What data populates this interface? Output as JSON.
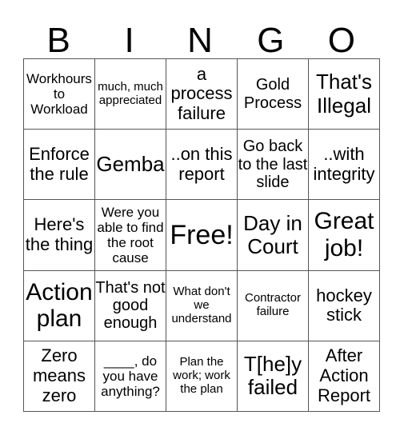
{
  "header": [
    "B",
    "I",
    "N",
    "G",
    "O"
  ],
  "rows": [
    [
      "Workhours to Workload",
      "much, much appreciated",
      "a process failure",
      "Gold Process",
      "That's Illegal"
    ],
    [
      "Enforce the rule",
      "Gemba",
      "..on this report",
      "Go back to the last slide",
      "..with integrity"
    ],
    [
      "Here's the thing",
      "Were you able to find the root cause",
      "Free!",
      "Day in Court",
      "Great job!"
    ],
    [
      "Action plan",
      "That's not good enough",
      "What don't we understand",
      "Contractor failure",
      "hockey stick"
    ],
    [
      "Zero means zero",
      "____, do you have anything?",
      "Plan the work; work the plan",
      "T[he]y failed",
      "After Action Report"
    ]
  ]
}
